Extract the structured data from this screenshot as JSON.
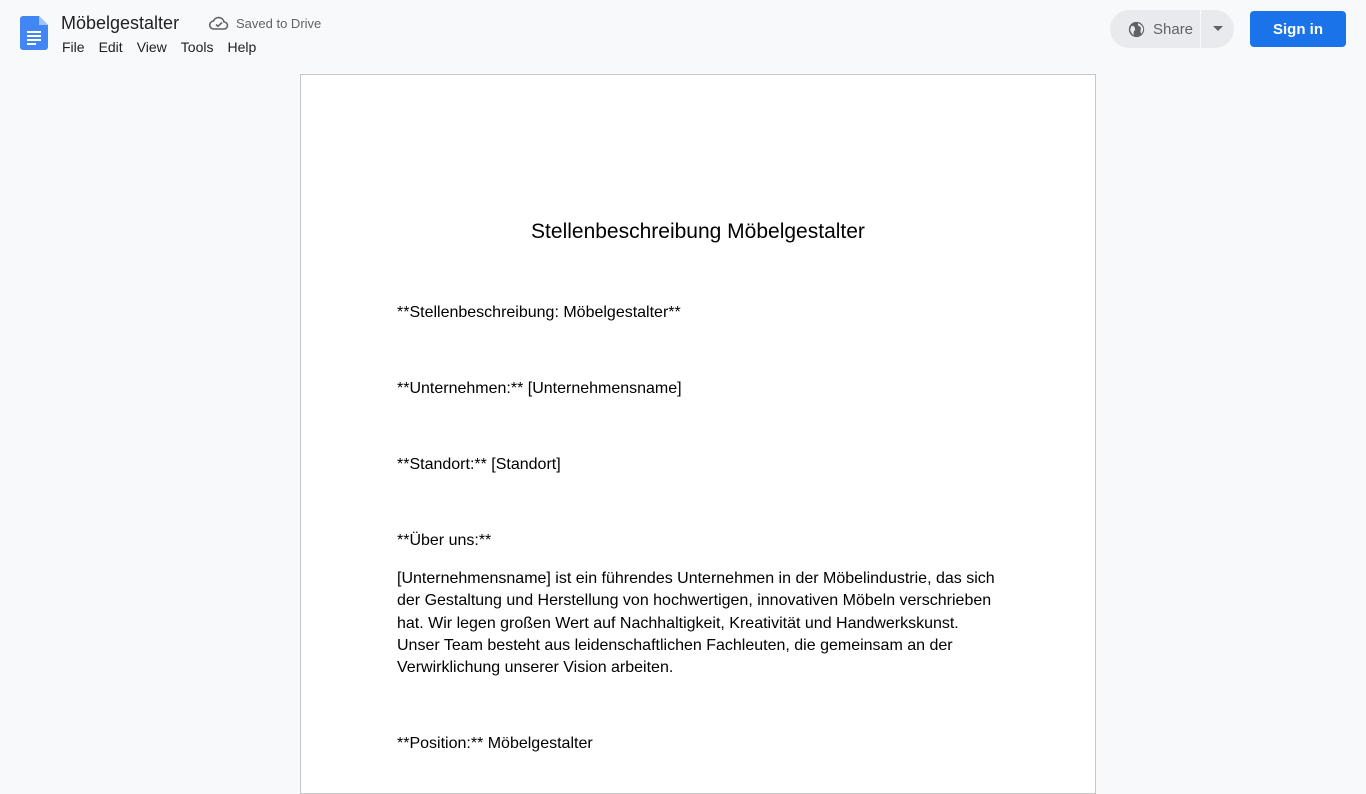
{
  "app": {
    "title": "Möbelgestalter",
    "save_status": "Saved to Drive",
    "menu": [
      "File",
      "Edit",
      "View",
      "Tools",
      "Help"
    ],
    "share_label": "Share",
    "signin_label": "Sign in",
    "colors": {
      "brand_blue": "#1a73e8",
      "doc_icon_blue": "#4285f4"
    }
  },
  "document": {
    "heading": "Stellenbeschreibung Möbelgestalter",
    "paragraphs": [
      "**Stellenbeschreibung: Möbelgestalter**",
      "**Unternehmen:** [Unternehmensname]",
      "**Standort:** [Standort]",
      "**Über uns:**",
      "[Unternehmensname] ist ein führendes Unternehmen in der Möbelindustrie, das sich der Gestaltung und Herstellung von hochwertigen, innovativen Möbeln verschrieben hat. Wir legen großen Wert auf Nachhaltigkeit, Kreativität und Handwerkskunst. Unser Team besteht aus leidenschaftlichen Fachleuten, die gemeinsam an der Verwirklichung unserer Vision arbeiten.",
      "**Position:** Möbelgestalter"
    ]
  }
}
